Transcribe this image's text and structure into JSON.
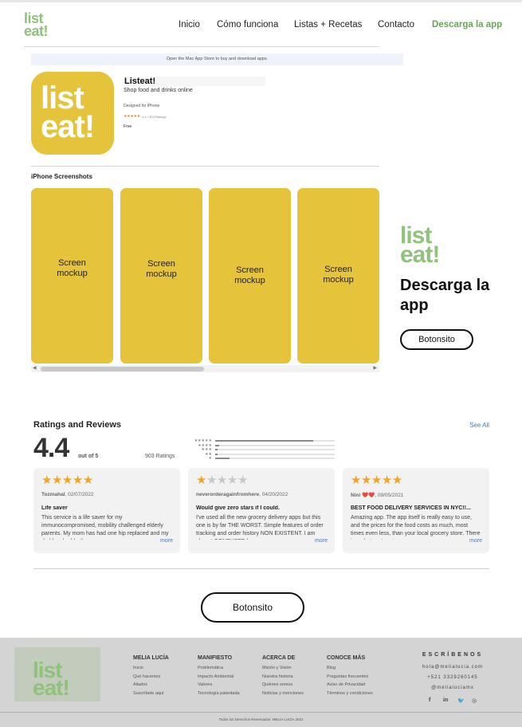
{
  "header": {
    "logo_line1": "list",
    "logo_line2": "eat!",
    "nav": [
      "Inicio",
      "Cómo funciona",
      "Listas + Recetas",
      "Contacto",
      "Descarga la app"
    ]
  },
  "store": {
    "banner": "Open the Mac App Store to buy and download apps.",
    "icon_line1": "list",
    "icon_line2": "eat!",
    "app_name": "Listeat!",
    "app_subtitle": "Shop food and drinks online",
    "designed_for": "Designed for iPhone",
    "stars": "★★★★★",
    "rating_text": "4.4 • 903 Ratings",
    "price": "Free",
    "screenshots_title": "iPhone Screenshots",
    "screenshots": [
      "Screen\nmockup",
      "Screen\nmockup",
      "Screen\nmockup",
      "Screen\nmockup"
    ]
  },
  "promo": {
    "logo_line1": "list",
    "logo_line2": "eat!",
    "title": "Descarga la app",
    "button": "Botonsito"
  },
  "ratings": {
    "title": "Ratings and Reviews",
    "see_all": "See All",
    "score": "4.4",
    "out_of": "out of 5",
    "count": "903 Ratings",
    "distribution": [
      {
        "stars": "★★★★★",
        "fraction": 0.82
      },
      {
        "stars": "★★★★",
        "fraction": 0.03
      },
      {
        "stars": "★★★",
        "fraction": 0.02
      },
      {
        "stars": "★★",
        "fraction": 0.02
      },
      {
        "stars": "★",
        "fraction": 0.12
      }
    ],
    "reviews": [
      {
        "rating": 5,
        "author": "Tozmahal",
        "date": ", 02/07/2022",
        "title": "Life saver",
        "body": "This service is a life saver for my immunocompromised, mobility challenged elderly parents. My mom has had one hip replaced and my dad has had both.",
        "more": "more"
      },
      {
        "rating": 1,
        "author": "neverorderagainfromhere",
        "date": ", 04/20/2022",
        "title": "Would give zero stars if I could.",
        "body": "I've used all the new grocery delivery apps but this one is by far THE WORST. Simple features of order tracking and order history NON EXISTENT. I am almost CONFUSED how",
        "more": "more"
      },
      {
        "rating": 5,
        "author": "Nini ❤️❤️",
        "date": ", 09/05/2021",
        "title": "BEST FOOD DELIVERY SERVICES IN NYC!!...",
        "body": "Amazing app. The app itself is really easy to use, and the prices for the food costs as much, most times even less, than your local grocery store. There is a chat system to",
        "more": "more"
      }
    ]
  },
  "center_button": "Botonsito",
  "footer": {
    "logo_line1": "list",
    "logo_line2": "eat!",
    "columns": [
      {
        "head": "MELIA LUCÍA",
        "links": [
          "Inicio",
          "Qué hacemos",
          "Aliados",
          "Suscríbete aquí"
        ]
      },
      {
        "head": "MANIFIESTO",
        "links": [
          "Problemática",
          "Impacto Ambiental",
          "Valores",
          "Tecnología patentada"
        ]
      },
      {
        "head": "ACERCA DE",
        "links": [
          "Misión y Visión",
          "Nuestra historia",
          "Quiénes somos",
          "Noticias y menciones"
        ]
      },
      {
        "head": "CONOCE MÁS",
        "links": [
          "Blog",
          "Preguntas frecuentes",
          "Aviso de Privacidad",
          "Términos y condiciones"
        ]
      }
    ],
    "contact_head": "ESCRÍBENOS",
    "contact_lines": [
      "hola@melialucia.com",
      "+521 3329260145",
      "@melialuciamx"
    ],
    "social": [
      {
        "icon": "facebook-icon",
        "glyph": "f"
      },
      {
        "icon": "linkedin-icon",
        "glyph": "in"
      },
      {
        "icon": "twitter-icon",
        "glyph": "🐦"
      },
      {
        "icon": "instagram-icon",
        "glyph": "◎"
      }
    ],
    "copyright": "Todos los Derechos Reservados. MELIA LUCÍA 2021"
  }
}
